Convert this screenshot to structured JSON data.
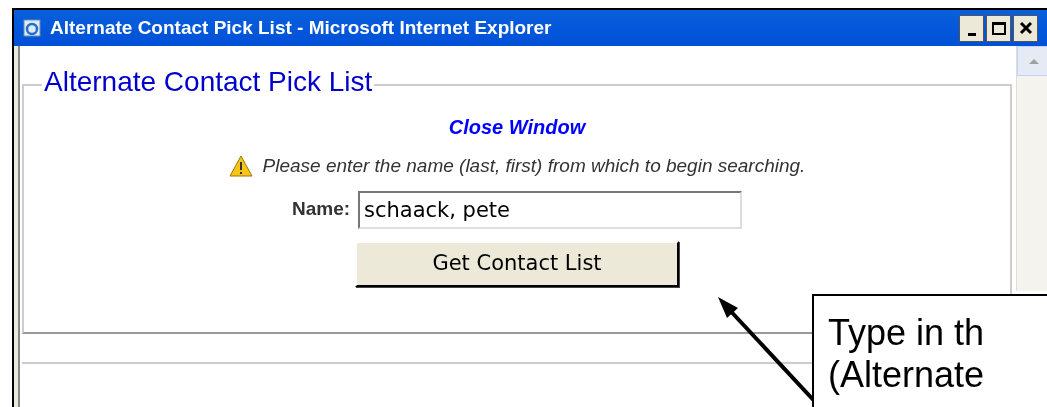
{
  "window": {
    "title": "Alternate Contact Pick List - Microsoft Internet Explorer"
  },
  "page": {
    "legend": "Alternate Contact Pick List",
    "close_link": "Close Window",
    "instruction": "Please enter the name (last, first) from which to begin searching.",
    "name_label": "Name:",
    "name_value": "schaack, pete",
    "submit_button": "Get Contact List"
  },
  "callout": {
    "lines": [
      "Type in th",
      "(Alternate"
    ]
  }
}
